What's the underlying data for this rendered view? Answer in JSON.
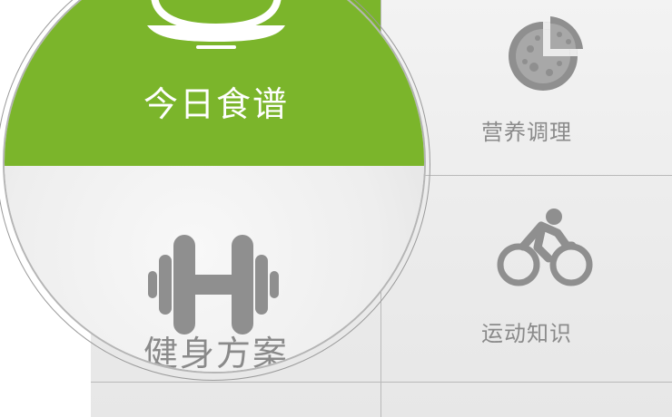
{
  "tiles": {
    "recipe": {
      "label": "今日食谱",
      "icon": "bowl-icon"
    },
    "nutrition": {
      "label": "营养调理",
      "icon": "pizza-icon"
    },
    "fitness": {
      "label": "健身方案",
      "icon": "dumbbell-icon"
    },
    "exercise": {
      "label": "运动知识",
      "icon": "cyclist-icon"
    }
  },
  "colors": {
    "accent_green": "#7bb52b",
    "icon_gray": "#8f8f8f",
    "label_gray": "#8a8a8a",
    "grid_line": "#b9b9b9"
  }
}
